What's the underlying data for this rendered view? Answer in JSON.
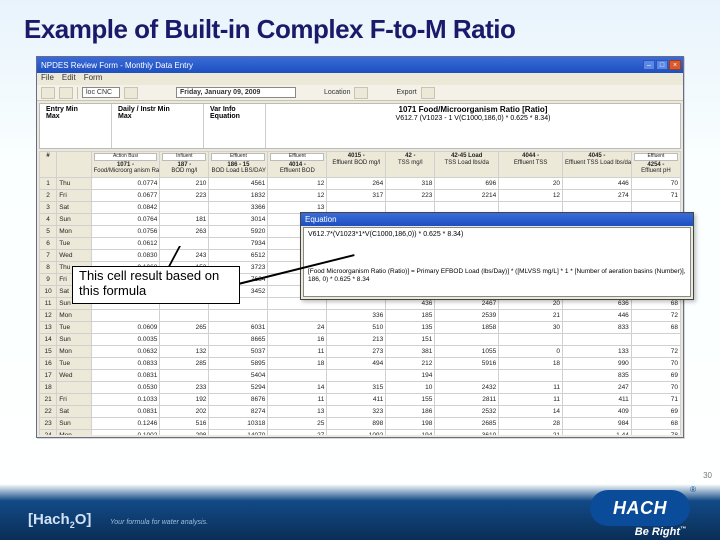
{
  "slide": {
    "title": "Example of Built-in Complex F-to-M Ratio",
    "page_number": "30"
  },
  "window": {
    "title": "NPDES Review Form - Monthly Data Entry",
    "menu": [
      "File",
      "Edit",
      "Form"
    ],
    "toolbar_date": "Friday, January 09, 2009",
    "toolbar_label_loc": "Location",
    "toolbar_label_exp": "Export"
  },
  "header": {
    "left1": "Entry Min",
    "left2": "Max",
    "mid1": "Daily / Instr Min",
    "mid2": "Max",
    "right1": "Var Info",
    "right2": "Equation",
    "var_title": "1071 Food/Microorganism Ratio [Ratio]",
    "eq_line": "V612.7 (V1023 - 1 V(C1000,186,0) * 0.625 * 8.34)"
  },
  "columns": [
    {
      "ab": "",
      "main": "#",
      "sub": ""
    },
    {
      "ab": "",
      "main": "",
      "sub": ""
    },
    {
      "ab": "Action Busi",
      "main": "1071 -",
      "sub": "Food/Microorg anism Ratio"
    },
    {
      "ab": "Influent",
      "main": "187 -",
      "sub": "BOD mg/l"
    },
    {
      "ab": "Effluent",
      "main": "186 - 15",
      "sub": "BOD Load LBS/DAY"
    },
    {
      "ab": "Effluent",
      "main": "4014 -",
      "sub": "Effluent BOD"
    },
    {
      "ab": "",
      "main": "4015 -",
      "sub": "Effluent BOD mg/l"
    },
    {
      "ab": "",
      "main": "42 -",
      "sub": "TSS mg/l"
    },
    {
      "ab": "",
      "main": "42-45 Load",
      "sub": "TSS Load lbs/da"
    },
    {
      "ab": "",
      "main": "4044 -",
      "sub": "Effluent TSS"
    },
    {
      "ab": "",
      "main": "4045 -",
      "sub": "Effluent TSS Load lbs/day"
    },
    {
      "ab": "Effluent",
      "main": "4254 -",
      "sub": "Effluent pH"
    }
  ],
  "rows": [
    {
      "n": "1",
      "d": "Thu",
      "v": [
        "0.0774",
        "210",
        "4561",
        "12",
        "264",
        "318",
        "696",
        "20",
        "446",
        "70"
      ]
    },
    {
      "n": "2",
      "d": "Fri",
      "v": [
        "0.0677",
        "223",
        "1832",
        "12",
        "317",
        "223",
        "2214",
        "12",
        "274",
        "71"
      ]
    },
    {
      "n": "3",
      "d": "Sat",
      "v": [
        "0.0842",
        "",
        "3366",
        "13",
        "",
        "",
        "",
        "",
        "",
        ""
      ]
    },
    {
      "n": "4",
      "d": "Sun",
      "v": [
        "0.0764",
        "181",
        "3014",
        "17",
        "",
        "",
        "",
        "",
        "",
        ""
      ]
    },
    {
      "n": "5",
      "d": "Mon",
      "v": [
        "0.0756",
        "263",
        "5920",
        "13",
        "",
        "",
        "",
        "",
        "",
        ""
      ]
    },
    {
      "n": "6",
      "d": "Tue",
      "v": [
        "0.0612",
        "",
        "7934",
        "21",
        "",
        "",
        "",
        "",
        "",
        ""
      ]
    },
    {
      "n": "7",
      "d": "Wed",
      "v": [
        "0.0830",
        "243",
        "6512",
        "",
        "",
        "",
        "",
        "",
        "",
        ""
      ]
    },
    {
      "n": "8",
      "d": "Thu",
      "v": [
        "0.1068",
        "153",
        "3723",
        "41",
        "",
        "",
        "",
        "",
        "",
        ""
      ]
    },
    {
      "n": "9",
      "d": "Fri",
      "v": [
        "0.1036",
        "221",
        "7634",
        "",
        "",
        "",
        "",
        "",
        "",
        ""
      ]
    },
    {
      "n": "10",
      "d": "Sat",
      "v": [
        "0.0668",
        "34",
        "3452",
        "27",
        "",
        "",
        "",
        "",
        "",
        ""
      ]
    },
    {
      "n": "11",
      "d": "Sun",
      "v": [
        "",
        "",
        "",
        "",
        "",
        "436",
        "2467",
        "20",
        "636",
        "68"
      ]
    },
    {
      "n": "12",
      "d": "Mon",
      "v": [
        "",
        "",
        "",
        "",
        "336",
        "185",
        "2539",
        "21",
        "446",
        "72"
      ]
    },
    {
      "n": "13",
      "d": "Tue",
      "v": [
        "0.0609",
        "265",
        "6031",
        "24",
        "510",
        "135",
        "1858",
        "30",
        "833",
        "68"
      ]
    },
    {
      "n": "14",
      "d": "Sun",
      "v": [
        "0.0035",
        "",
        "8665",
        "16",
        "213",
        "151",
        "",
        "",
        "",
        ""
      ]
    },
    {
      "n": "15",
      "d": "Mon",
      "v": [
        "0.0632",
        "132",
        "5037",
        "11",
        "273",
        "381",
        "1055",
        "0",
        "133",
        "72"
      ]
    },
    {
      "n": "16",
      "d": "Tue",
      "v": [
        "0.0833",
        "285",
        "5895",
        "18",
        "494",
        "212",
        "5916",
        "18",
        "990",
        "70"
      ]
    },
    {
      "n": "17",
      "d": "Wed",
      "v": [
        "0.0831",
        "",
        "5404",
        "",
        "",
        "194",
        "",
        "",
        "835",
        "69"
      ]
    },
    {
      "n": "18",
      "d": "",
      "v": [
        "0.0530",
        "233",
        "5294",
        "14",
        "315",
        "10",
        "2432",
        "11",
        "247",
        "70"
      ]
    },
    {
      "n": "21",
      "d": "Fri",
      "v": [
        "0.1033",
        "192",
        "8676",
        "11",
        "411",
        "155",
        "2811",
        "11",
        "411",
        "71"
      ]
    },
    {
      "n": "22",
      "d": "Sat",
      "v": [
        "0.0831",
        "202",
        "8274",
        "13",
        "323",
        "186",
        "2532",
        "14",
        "409",
        "69"
      ]
    },
    {
      "n": "23",
      "d": "Sun",
      "v": [
        "0.1246",
        "516",
        "10318",
        "25",
        "898",
        "198",
        "2685",
        "28",
        "984",
        "68"
      ]
    },
    {
      "n": "24",
      "d": "Mon",
      "v": [
        "0.1002",
        "298",
        "14070",
        "27",
        "1092",
        "194",
        "3610",
        "21",
        "1.44",
        "78"
      ]
    }
  ],
  "selected_row_index": 8,
  "callout_text": "This cell result based on this formula",
  "eq_popup": {
    "title": "Equation",
    "formula": "V612.7*(V1023*1*V(C1000,186,0)) * 0.625 * 8.34)",
    "desc": "[Food Microorganism Ratio (Ratio)] = Primary EFBOD Load (lbs/Day)] * ([MLVSS mg/L] * 1 * [Number of aeration basins (Number)], 186, 0) * 0.625 * 8.34"
  },
  "footer": {
    "logo": "HACH",
    "slogan": "Be Right",
    "left_logo": "Hach",
    "left_sub": "2",
    "left_o": "O",
    "tagline": "Your formula for water analysis."
  }
}
